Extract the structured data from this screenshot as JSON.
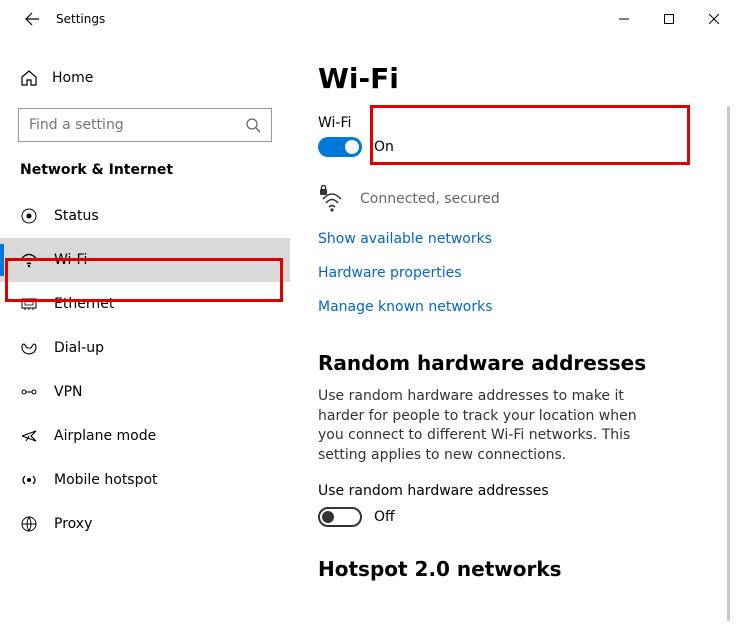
{
  "titlebar": {
    "title": "Settings"
  },
  "sidebar": {
    "home": "Home",
    "search_placeholder": "Find a setting",
    "category": "Network & Internet",
    "items": [
      {
        "label": "Status",
        "icon": "status-icon"
      },
      {
        "label": "Wi-Fi",
        "icon": "wifi-icon",
        "selected": true
      },
      {
        "label": "Ethernet",
        "icon": "ethernet-icon"
      },
      {
        "label": "Dial-up",
        "icon": "dialup-icon"
      },
      {
        "label": "VPN",
        "icon": "vpn-icon"
      },
      {
        "label": "Airplane mode",
        "icon": "airplane-icon"
      },
      {
        "label": "Mobile hotspot",
        "icon": "hotspot-icon"
      },
      {
        "label": "Proxy",
        "icon": "proxy-icon"
      }
    ]
  },
  "content": {
    "page_heading": "Wi-Fi",
    "wifi_section": {
      "label": "Wi-Fi",
      "state": "On",
      "on": true
    },
    "connection": {
      "status": "Connected, secured"
    },
    "links": {
      "show_networks": "Show available networks",
      "hw_props": "Hardware properties",
      "manage_known": "Manage known networks"
    },
    "random_mac": {
      "heading": "Random hardware addresses",
      "desc": "Use random hardware addresses to make it harder for people to track your location when you connect to different Wi-Fi networks. This setting applies to new connections.",
      "toggle_label": "Use random hardware addresses",
      "state": "Off",
      "on": false
    },
    "hotspot2": {
      "heading": "Hotspot 2.0 networks"
    }
  }
}
